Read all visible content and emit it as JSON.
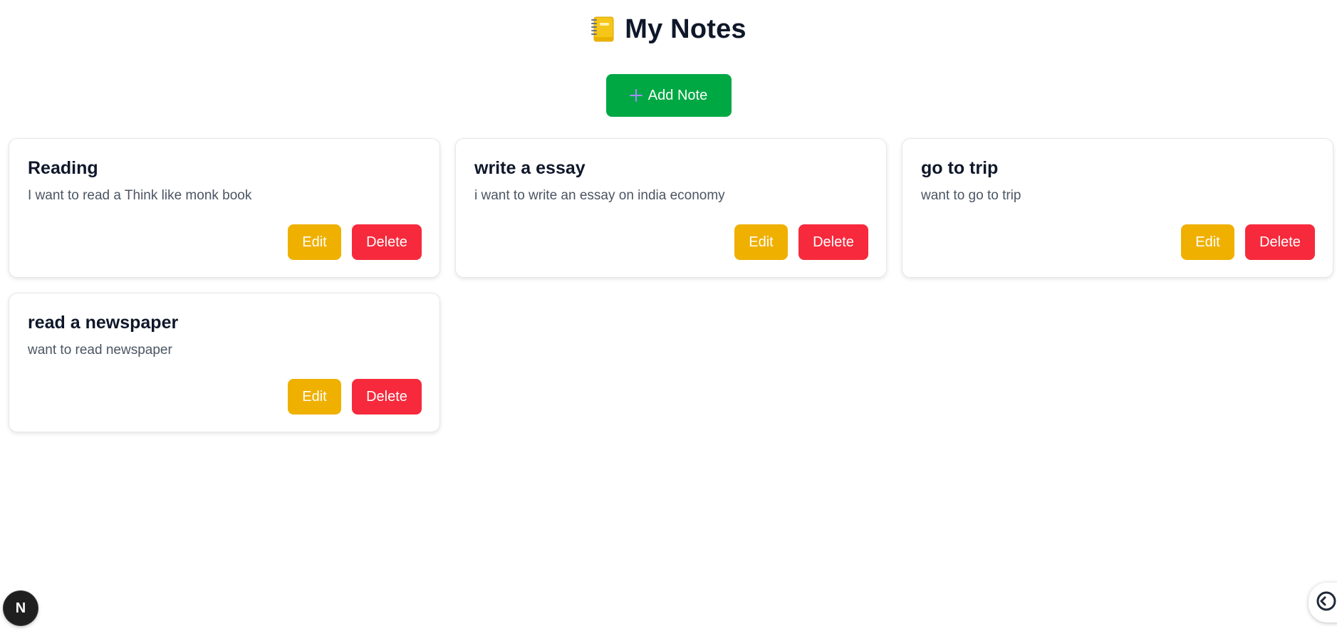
{
  "header": {
    "icon": "notebook-icon",
    "title": "My Notes"
  },
  "toolbar": {
    "add_icon": "plus-icon",
    "add_label": "Add Note"
  },
  "notes": [
    {
      "title": "Reading",
      "content": "I want to read a Think like monk book",
      "edit_label": "Edit",
      "delete_label": "Delete"
    },
    {
      "title": "write a essay",
      "content": "i want to write an essay on india economy",
      "edit_label": "Edit",
      "delete_label": "Delete"
    },
    {
      "title": "go to trip",
      "content": "want to go to trip",
      "edit_label": "Edit",
      "delete_label": "Delete"
    },
    {
      "title": "read a newspaper",
      "content": "want to read newspaper",
      "edit_label": "Edit",
      "delete_label": "Delete"
    }
  ],
  "dev_badge": {
    "label": "N",
    "icon": "nextjs-logo-icon"
  },
  "corner_widget": {
    "icon": "code-toggle-icon"
  },
  "colors": {
    "add_button": "#00a844",
    "edit_button": "#efb000",
    "delete_button": "#f62a3c",
    "title_text": "#0f172a",
    "body_text": "#4b5563"
  }
}
